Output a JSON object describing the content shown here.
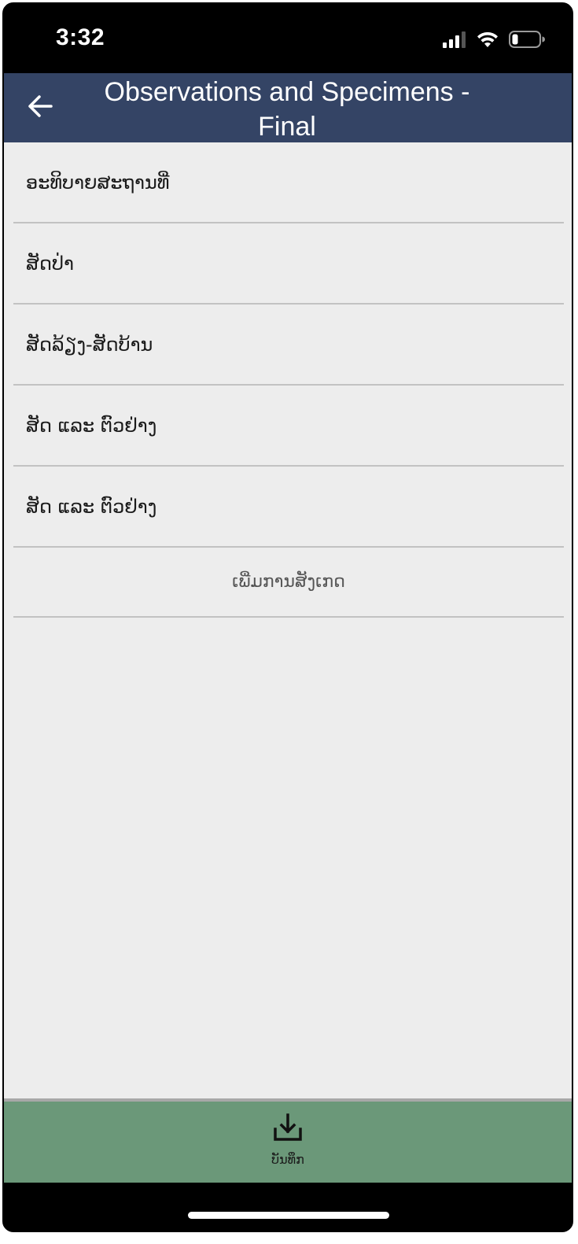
{
  "status_bar": {
    "time": "3:32",
    "icons": [
      "signal-icon",
      "wifi-icon",
      "battery-icon"
    ]
  },
  "header": {
    "title": "Observations and Specimens - Final",
    "back_icon": "arrow-left-icon"
  },
  "list": {
    "items": [
      {
        "label": "ອະທິບາຍສະຖານທີ່"
      },
      {
        "label": "ສັດປ່າ"
      },
      {
        "label": "ສັດລ້ຽງ-ສັດບ້ານ"
      },
      {
        "label": "ສັດ ແລະ ຕົວຢ່າງ"
      },
      {
        "label": "ສັດ ແລະ ຕົວຢ່າງ"
      }
    ],
    "add_observation_label": "ເພີ່ມການສັງເກດ"
  },
  "save_bar": {
    "label": "ບັນທຶກ",
    "icon": "download-icon"
  },
  "colors": {
    "header_bg": "#344465",
    "content_bg": "#ededed",
    "save_bar_bg": "#6b9879"
  }
}
